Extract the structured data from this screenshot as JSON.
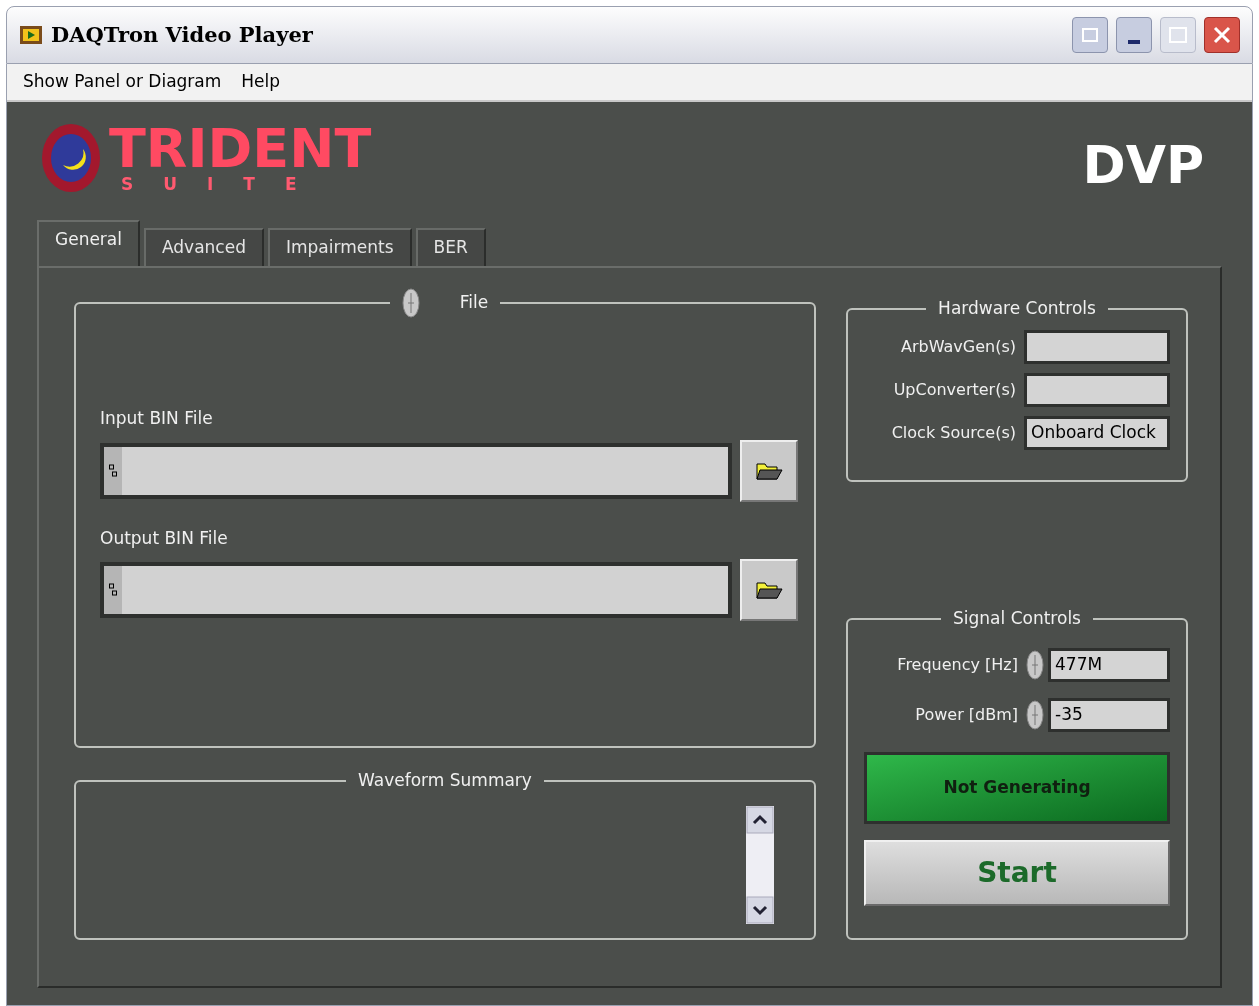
{
  "window": {
    "title": "DAQTron Video Player"
  },
  "menu": [
    "Show Panel or Diagram",
    "Help"
  ],
  "logo": {
    "name": "TRIDENT",
    "subtitle": "SUITE"
  },
  "badge": "DVP",
  "tabs": [
    {
      "label": "General",
      "selected": true
    },
    {
      "label": "Advanced",
      "selected": false
    },
    {
      "label": "Impairments",
      "selected": false
    },
    {
      "label": "BER",
      "selected": false
    }
  ],
  "file_group": {
    "title": "File",
    "fields": [
      {
        "label": "Input BIN File"
      },
      {
        "label": "Output BIN File"
      }
    ]
  },
  "waveform_summary": {
    "title": "Waveform Summary"
  },
  "hardware_controls": {
    "title": "Hardware Controls",
    "rows": [
      {
        "label": "ArbWavGen(s)"
      },
      {
        "label": "UpConverter(s)"
      },
      {
        "label": "Clock Source(s)",
        "value": "Onboard Clock"
      }
    ]
  },
  "signal_controls": {
    "title": "Signal Controls",
    "rows": [
      {
        "label": "Frequency [Hz]",
        "value": "477M"
      },
      {
        "label": "Power [dBm]",
        "value": "-35"
      }
    ],
    "indicator": {
      "label": "Not Generating",
      "on": false
    },
    "button": "Start"
  }
}
